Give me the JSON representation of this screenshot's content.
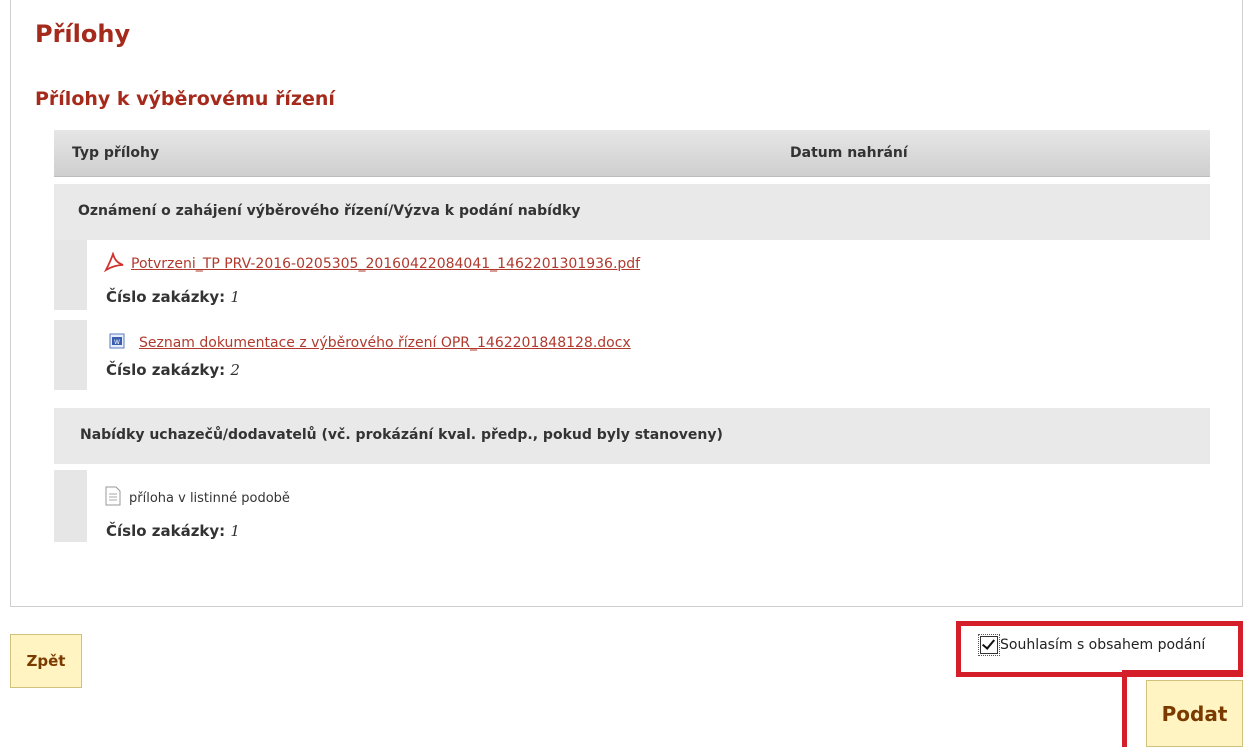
{
  "page": {
    "title": "Přílohy",
    "subtitle": "Přílohy k výběrovému řízení"
  },
  "table": {
    "columns": [
      "Typ přílohy",
      "Datum nahrání"
    ],
    "groups": [
      {
        "label": "Oznámení o zahájení výběrového řízení/Výzva k podání nabídky",
        "items": [
          {
            "icon": "pdf-icon",
            "name": "Potvrzeni_TP PRV-2016-0205305_20160422084041_1462201301936.pdf",
            "link": true,
            "order_label": "Číslo zakázky:",
            "order_value": "1"
          },
          {
            "icon": "word-doc-icon",
            "name": "Seznam dokumentace z výběrového řízení OPR_1462201848128.docx",
            "link": true,
            "order_label": "Číslo zakázky:",
            "order_value": "2"
          }
        ]
      },
      {
        "label": "Nabídky uchazečů/dodavatelů (vč. prokázání kval. předp., pokud byly stanoveny)",
        "items": [
          {
            "icon": "text-document-icon",
            "name": "příloha v listinné podobě",
            "link": false,
            "order_label": "Číslo zakázky:",
            "order_value": "1"
          }
        ]
      }
    ]
  },
  "footer": {
    "back_label": "Zpět",
    "agree_label": "Souhlasím s obsahem podání",
    "agree_checked": true,
    "submit_label": "Podat"
  },
  "colors": {
    "heading": "#a52a1c",
    "link": "#b03a2e",
    "highlight": "#d41f2a",
    "button_bg": "#fff4c2"
  }
}
